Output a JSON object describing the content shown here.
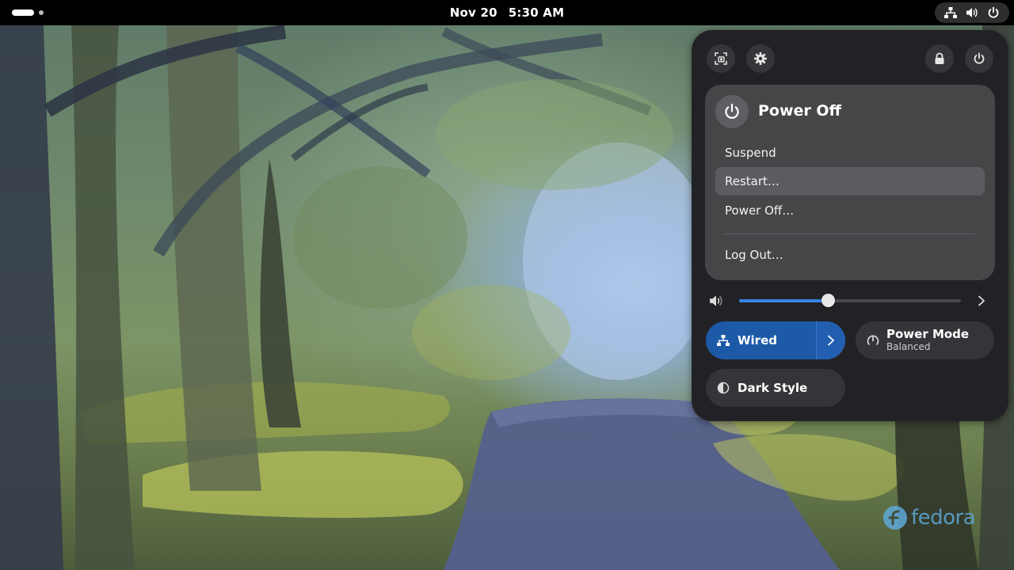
{
  "topbar": {
    "date": "Nov 20",
    "time": "5:30 AM"
  },
  "quick_settings": {
    "power_menu": {
      "title": "Power Off",
      "items": [
        {
          "label": "Suspend"
        },
        {
          "label": "Restart…"
        },
        {
          "label": "Power Off…"
        },
        {
          "label": "Log Out…"
        }
      ]
    },
    "volume": {
      "level_percent": 40
    },
    "toggles": {
      "wired": {
        "label": "Wired",
        "active": true
      },
      "power_mode": {
        "label": "Power Mode",
        "subtitle": "Balanced"
      },
      "dark_style": {
        "label": "Dark Style"
      }
    }
  },
  "icons": {
    "screenshot": "screenshot-icon",
    "settings": "gear-icon",
    "lock": "lock-icon",
    "power": "power-icon",
    "network": "network-wired-icon",
    "volume": "speaker-icon"
  },
  "colors": {
    "accent": "#3584e4",
    "wired_toggle": "#1c5aa8",
    "panel_bg": "#222226",
    "submenu_bg": "#464649"
  },
  "watermark": {
    "text": "fedora"
  }
}
